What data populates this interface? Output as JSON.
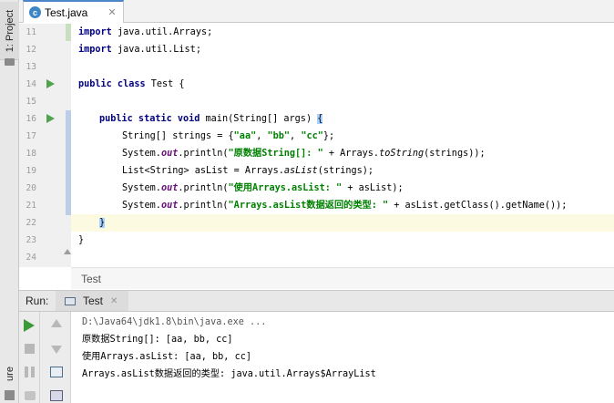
{
  "left_strip": {
    "project_tab": "1: Project",
    "structure_tab": "ure"
  },
  "editor": {
    "tab_label": "Test.java",
    "tab_icon_letter": "c",
    "breadcrumb": "Test",
    "line_numbers": [
      "11",
      "12",
      "13",
      "14",
      "15",
      "16",
      "17",
      "18",
      "19",
      "20",
      "21",
      "22",
      "23",
      "24"
    ],
    "code": {
      "l11": [
        "import",
        " java.util.Arrays;"
      ],
      "l12": [
        "import",
        " java.util.List;"
      ],
      "l14": [
        "public class",
        " Test {"
      ],
      "l16": [
        "public static void",
        " main(String[] args) ",
        "{"
      ],
      "l17": [
        "String[] strings = {",
        "\"aa\"",
        ", ",
        "\"bb\"",
        ", ",
        "\"cc\"",
        "};"
      ],
      "l18": [
        "System.",
        "out",
        ".println(",
        "\"原数据String[]: \"",
        " + Arrays.",
        "toString",
        "(strings));"
      ],
      "l19": [
        "List<String> asList = Arrays.",
        "asList",
        "(strings);"
      ],
      "l20": [
        "System.",
        "out",
        ".println(",
        "\"使用Arrays.asList: \"",
        " + asList);"
      ],
      "l21": [
        "System.",
        "out",
        ".println(",
        "\"Arrays.asList数据返回的类型: \"",
        " + asList.getClass().getName());"
      ],
      "l22": [
        "}"
      ],
      "l23": [
        "}"
      ]
    }
  },
  "run_panel": {
    "label": "Run:",
    "tab_label": "Test",
    "console": [
      "D:\\Java64\\jdk1.8\\bin\\java.exe ...",
      "原数据String[]: [aa, bb, cc]",
      "使用Arrays.asList: [aa, bb, cc]",
      "Arrays.asList数据返回的类型: java.util.Arrays$ArrayList"
    ]
  },
  "colors": {
    "keyword": "#000080",
    "string": "#008000",
    "field": "#660e7a",
    "run_arrow": "#4fa34f",
    "current_line": "#fcfae0",
    "brace_highlight": "#a6d2ff"
  }
}
